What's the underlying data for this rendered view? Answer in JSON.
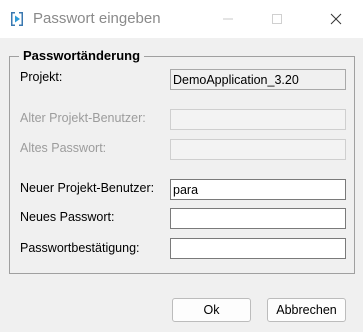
{
  "window": {
    "title": "Passwort eingeben"
  },
  "group": {
    "legend": "Passwortänderung"
  },
  "fields": {
    "project": {
      "label": "Projekt:",
      "value": "DemoApplication_3.20"
    },
    "old_user": {
      "label": "Alter Projekt-Benutzer:",
      "value": ""
    },
    "old_password": {
      "label": "Altes Passwort:",
      "value": ""
    },
    "new_user": {
      "label": "Neuer Projekt-Benutzer:",
      "value": "para"
    },
    "new_password": {
      "label": "Neues Passwort:",
      "value": ""
    },
    "confirm_password": {
      "label": "Passwortbestätigung:",
      "value": ""
    }
  },
  "buttons": {
    "ok": "Ok",
    "cancel": "Abbrechen"
  },
  "icons": {
    "app": "app-icon",
    "minimize": "minimize-icon",
    "maximize": "maximize-icon",
    "close": "close-icon"
  }
}
